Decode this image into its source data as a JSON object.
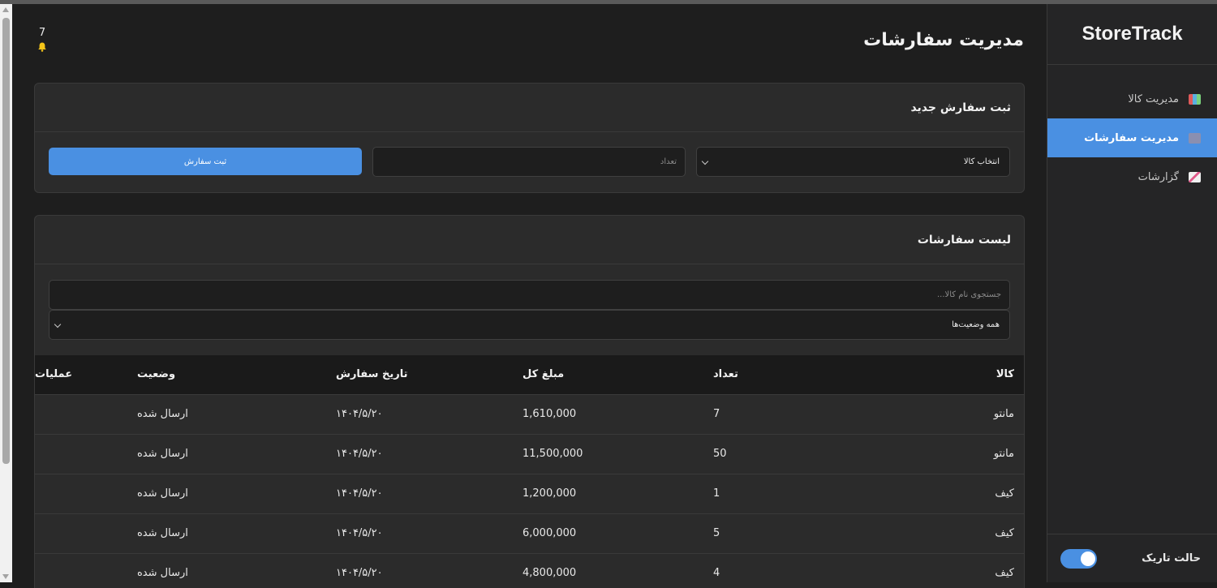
{
  "app": {
    "brand": "StoreTrack"
  },
  "sidebar": {
    "items": [
      {
        "label": "مدیریت کالا",
        "icon": "bar-chart-icon",
        "active": false
      },
      {
        "label": "مدیریت سفارشات",
        "icon": "cart-icon",
        "active": true
      },
      {
        "label": "گزارشات",
        "icon": "trend-chart-icon",
        "active": false
      }
    ],
    "dark_mode_label": "حالت تاریک",
    "dark_mode_on": true
  },
  "header": {
    "title": "مدیریت سفارشات",
    "notification_count": "7",
    "notification_icon": "bell-icon"
  },
  "new_order": {
    "title": "ثبت سفارش جدید",
    "product_select_value": "انتخاب کالا",
    "quantity_placeholder": "تعداد",
    "submit_label": "ثبت سفارش"
  },
  "order_list": {
    "title": "لیست سفارشات",
    "search_placeholder": "جستجوی نام کالا...",
    "status_filter_value": "همه وضعیت‌ها",
    "columns": [
      "کالا",
      "تعداد",
      "مبلغ کل",
      "تاریخ سفارش",
      "وضعیت",
      "عملیات"
    ],
    "rows": [
      {
        "product": "مانتو",
        "qty": "7",
        "total": "1,610,000",
        "date": "۱۴۰۴/۵/۲۰",
        "status": "ارسال شده",
        "actions": ""
      },
      {
        "product": "مانتو",
        "qty": "50",
        "total": "11,500,000",
        "date": "۱۴۰۴/۵/۲۰",
        "status": "ارسال شده",
        "actions": ""
      },
      {
        "product": "کیف",
        "qty": "1",
        "total": "1,200,000",
        "date": "۱۴۰۴/۵/۲۰",
        "status": "ارسال شده",
        "actions": ""
      },
      {
        "product": "کیف",
        "qty": "5",
        "total": "6,000,000",
        "date": "۱۴۰۴/۵/۲۰",
        "status": "ارسال شده",
        "actions": ""
      },
      {
        "product": "کیف",
        "qty": "4",
        "total": "4,800,000",
        "date": "۱۴۰۴/۵/۲۰",
        "status": "ارسال شده",
        "actions": ""
      }
    ]
  },
  "colors": {
    "accent": "#4a90e2",
    "background": "#1e1e1e",
    "card": "#2b2b2b",
    "bell": "#f5c518"
  }
}
